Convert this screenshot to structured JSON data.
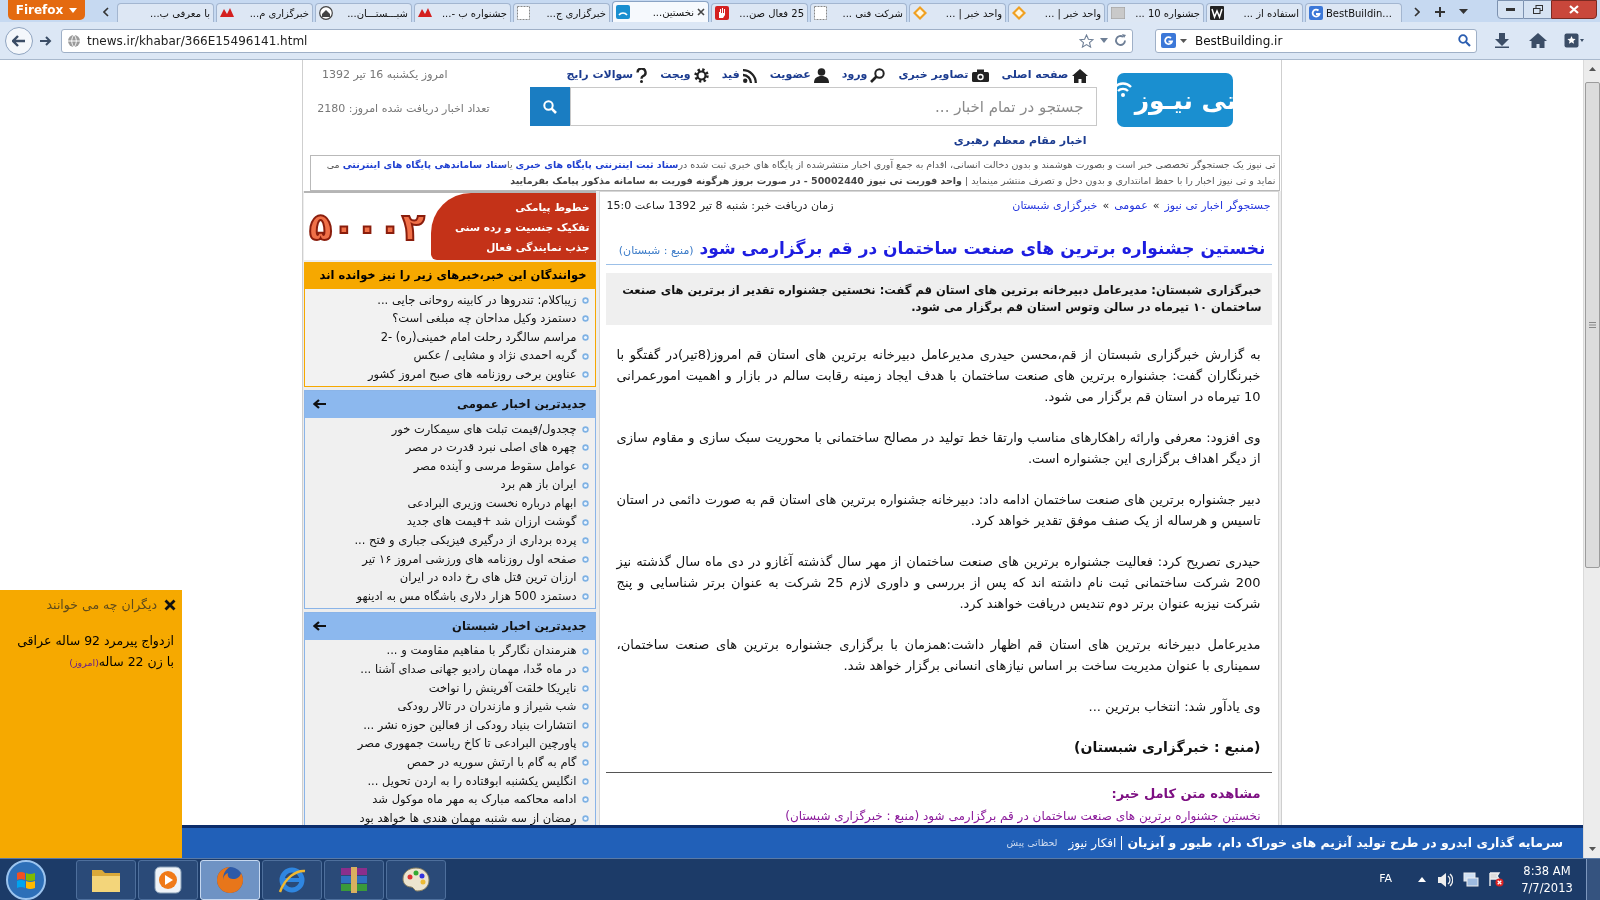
{
  "browser": {
    "menu_button": "Firefox",
    "tabs": [
      {
        "label": "BestBuildin...",
        "selected": false
      },
      {
        "label": "استفاده از ...",
        "selected": false
      },
      {
        "label": "جشنواره 10 ...",
        "selected": false
      },
      {
        "label": "واحد خبر | ...",
        "selected": false
      },
      {
        "label": "واحد خبر | ...",
        "selected": false
      },
      {
        "label": "شرکت فنی ...",
        "selected": false
      },
      {
        "label": "25 فعال صن...",
        "selected": false
      },
      {
        "label": "نخستین...",
        "selected": true
      },
      {
        "label": "خبرگزاری ج...",
        "selected": false
      },
      {
        "label": "جشنواره ب -...",
        "selected": false
      },
      {
        "label": "شبـــستـــان...",
        "selected": false
      },
      {
        "label": "خبرگزاری م...",
        "selected": false
      },
      {
        "label": "با معرفی ب...",
        "selected": false
      }
    ],
    "url": "tnews.ir/khabar/366E15496141.html",
    "search_value": "BestBuilding.ir"
  },
  "header": {
    "logo": "تی نیـوز",
    "nav": [
      "صفحه اصلی",
      "تصاویر خبری",
      "ورود",
      "عضویت",
      "فید",
      "ویجت",
      "سوالات رایج"
    ],
    "search_placeholder": "جستجو در تمام اخبار ...",
    "date": "امروز یکشنبه 16 تیر 1392",
    "news_count": "تعداد اخبار دریافت شده امروز: 2180",
    "leader_link": "اخبار مقام معظم رهبری",
    "notice": [
      {
        "kind": "text",
        "text": "تی نیوز یک جستجوگر تخصصی خبر است و بصورت هوشمند و بدون دخالت انسانی، اقدام به جمع آوری اخبار منتشرشده از پایگاه های خبری ثبت شده در"
      },
      {
        "kind": "link",
        "text": "ستاد ثبت اینترنتی پایگاه های خبری"
      },
      {
        "kind": "text",
        "text": " یا"
      },
      {
        "kind": "link",
        "text": "ستاد ساماندهی پایگاه های اینترنتی"
      },
      {
        "kind": "text",
        "text": " می نماید و تی نیوز اخبار را با حفظ امانتداری و بدون دخل و تصرف منتشر مینماید | "
      },
      {
        "kind": "bold",
        "text": "واحد فوریت تی نیوز 50002440 - در صورت بروز هرگونه فوریت به سامانه مذکور پیامک بفرمایید"
      }
    ]
  },
  "sidebar": {
    "ad": {
      "number": "۵۰۰۰۲",
      "lines": [
        "خطوط پیامکی",
        "تفکیک جنسیت و رده سنی",
        "جذب نمایندگی فعال"
      ]
    },
    "boxes": [
      {
        "kind": "related",
        "title": "خوانندگان این خبر،خبرهای زیر را نیز خوانده اند",
        "items": [
          "زیباکلام: تندروها در کابینه روحانی جایی ...",
          "دستمزد وکیل مداحان چه مبلغی است؟",
          "مراسم سالگرد رحلت امام خمینی(ره) -2",
          "گریه احمدی نژاد و مشایی / عکس",
          "عناوین برخی روزنامه های صبح امروز کشور"
        ]
      },
      {
        "kind": "latest",
        "title": "جدیدترین اخبار عمومی",
        "items": [
          "چجدول/قیمت تبلت های سیمکارت خور",
          "چهره های اصلی نبرد قدرت در مصر",
          "عوامل سقوط مرسی و آینده مصر",
          "ایران باز هم برد",
          "ابهام درباره نخست وزیری البرادعی",
          "گوشت ارزان شد +قیمت های جدید",
          "پرده برداری از درگیری فیزیکی جباری و فتح ...",
          "صفحه اول روزنامه های ورزشی امروز ۱۶ تیر",
          "ارزان ترین قتل های رخ داده در ایران",
          "دستمزد 500 هزار دلاری باشگاه مس به ادینهو"
        ]
      },
      {
        "kind": "latest",
        "title": "جدیدترین اخبار شبستان",
        "items": [
          "هنرمندان نگارگر با مفاهیم مقاومت و ...",
          "در ماه خّدا، مهمان رادیو جهانی صدای آشنا ...",
          "نایریکا خلقت آفرینش را نواخت",
          "شب شیراز و مازندران در تالار رودکی",
          "انتشارات بنیاد رودکی از فعالین حوزه نشر ...",
          "پاورچین البرادعی تا کاخ ریاست جمهوری مصر",
          "گام به گام با ارتش سوریه در حمص",
          "انگلیس یکشنبه ابوقتاده را به اردن تحویل ...",
          "ادامه محاکمه مبارک به مهر ماه موکول شد",
          "رمضان از سه شنبه مهمان هندی ها خواهد بود"
        ]
      }
    ]
  },
  "article": {
    "breadcrumb": [
      {
        "kind": "link",
        "text": "جستجوگر اخبار تی نیوز"
      },
      {
        "kind": "separator",
        "text": "»"
      },
      {
        "kind": "link",
        "text": "عمومی"
      },
      {
        "kind": "separator",
        "text": "»"
      },
      {
        "kind": "link",
        "text": "خبرگزاری شبستان"
      }
    ],
    "received": "زمان دریافت خبر: شنبه 8 تیر 1392 ساعت 15:0",
    "title": "نخستین جشنواره برترین های صنعت ساختمان در قم برگزارمی شود",
    "title_source": "(منبع : شبستان)",
    "lead": "خبرگزاری شبستان: مدیرعامل دبیرخانه برترین های استان قم گفت: نخستین جشنواره تقدیر از برترین های صنعت ساختمان ۱۰ تیرماه در سالن وتوس استان قم برگزار می شود.",
    "paragraphs": [
      "به گزارش خبرگزاری شبستان از قم،محسن حیدری مدیرعامل دبیرخانه برترین های استان قم امروز(8تیر)در گفتگو با خبرنگاران گفت: جشنواره برترین های صنعت ساختمان با هدف ایجاد زمینه رقابت سالم در بازار و اهمیت امورعمرانی 10 تیرماه در استان قم برگزار می شود.",
      "وی افزود: معرفی وارائه راهکارهای مناسب وارتقا خط تولید در مصالح ساختمانی با محوریت سبک سازی و مقاوم سازی از دیگر اهداف برگزاری این جشنواره است.",
      "دبیر جشنواره برترین های صنعت ساختمان ادامه داد: دبیرخانه جشنواره برترین های استان قم به صورت دائمی در استان تاسیس و هرساله از یک صنف موفق تقدیر خواهد کرد.",
      "حیدری تصریح کرد: فعالیت جشنواره برترین های صنعت ساختمان از مهر سال گذشته آغازو در دی ماه سال گذشته نیز 200 شرکت ساختمانی ثبت نام داشته اند که پس از بررسی و داوری لازم 25 شرکت به عنوان برتر شناسایی و پنج شرکت نیزبه عنوان برتر دوم تندیس دریافت خواهند کرد.",
      "مدیرعامل دبیرخانه برترین های استان قم اظهار داشت:همزمان با برگزاری جشنواره برترین های صنعت ساختمان، سمیناری با عنوان مدیریت ساخت بر اساس نیازهای انسانی برگزار خواهد شد.",
      "وی یادآور شد: انتخاب برترین ..."
    ],
    "source": "(منبع : خبرگزاری شبستان)",
    "full_text_heading": "مشاهده متن کامل خبر:",
    "full_text_link": "نخستین جشنواره برترین های صنعت ساختمان در قم برگزارمی شود (منبع : خبرگزاری شبستان)"
  },
  "popup": {
    "title": "دیگران چه می خوانند",
    "headline": "ازدواج پیرمرد 92 ساله عراقی با زن 22 ساله",
    "time": "(امروز)"
  },
  "ticker": {
    "headline": "سرمایه گذاری ابدرو در طرح تولید آنزیم های خوراک دام، طیور و آبزیان",
    "source": "افکار نیوز",
    "time": "لحظاتی پیش"
  },
  "taskbar": {
    "apps": [
      {
        "selected": false
      },
      {
        "selected": false
      },
      {
        "selected": true
      },
      {
        "selected": false
      },
      {
        "selected": false
      },
      {
        "selected": false
      }
    ],
    "language": "FA",
    "time": "8:38 AM",
    "date": "7/7/2013"
  }
}
